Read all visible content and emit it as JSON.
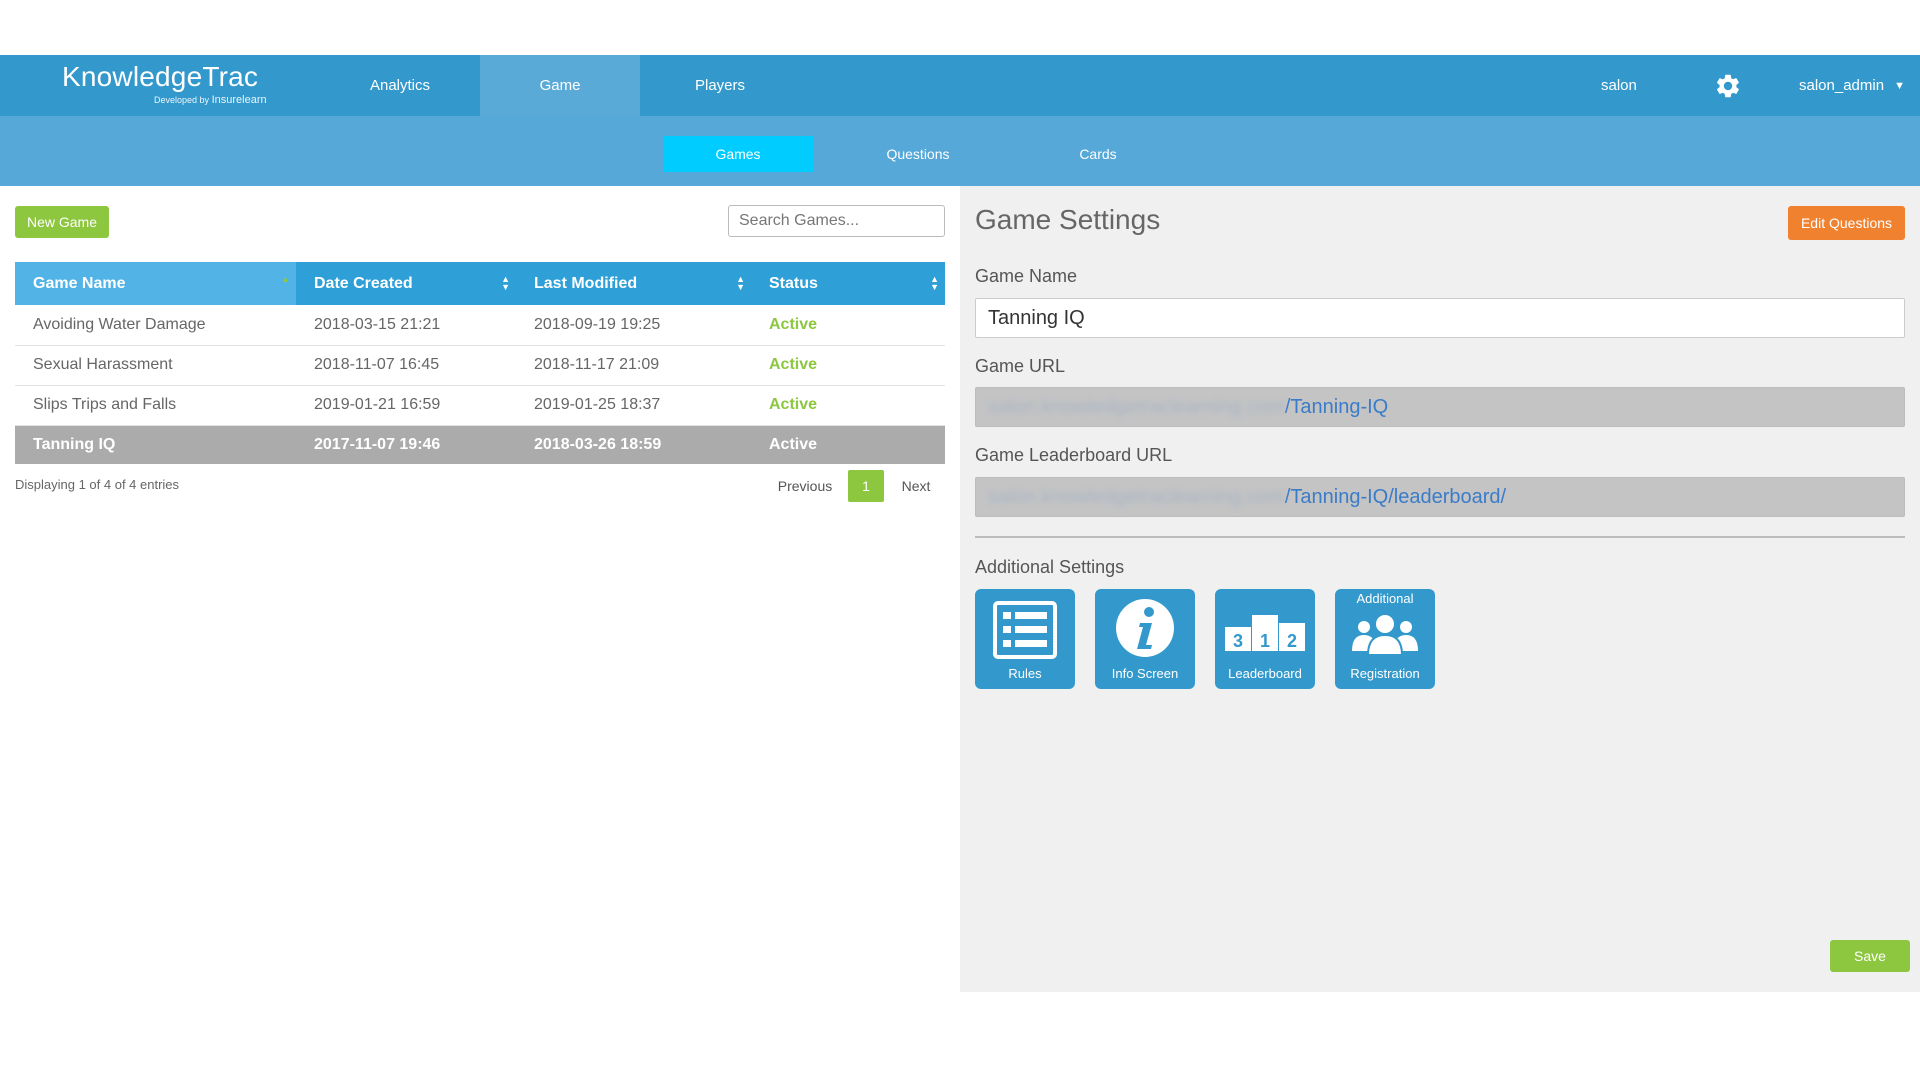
{
  "brand": {
    "name": "KnowledgeTrac",
    "sub_prefix": "Developed by",
    "sub_company": "Insurelearn"
  },
  "nav": {
    "items": [
      "Analytics",
      "Game",
      "Players"
    ],
    "active": "Game"
  },
  "user": {
    "org": "salon",
    "username": "salon_admin"
  },
  "subnav": {
    "items": [
      "Games",
      "Questions",
      "Cards"
    ],
    "active": "Games"
  },
  "left": {
    "new_game_label": "New Game",
    "search_placeholder": "Search Games...",
    "columns": [
      "Game Name",
      "Date Created",
      "Last Modified",
      "Status"
    ],
    "rows": [
      {
        "name": "Avoiding Water Damage",
        "created": "2018-03-15 21:21",
        "modified": "2018-09-19 19:25",
        "status": "Active"
      },
      {
        "name": "Sexual Harassment",
        "created": "2018-11-07 16:45",
        "modified": "2018-11-17 21:09",
        "status": "Active"
      },
      {
        "name": "Slips Trips and Falls",
        "created": "2019-01-21 16:59",
        "modified": "2019-01-25 18:37",
        "status": "Active"
      },
      {
        "name": "Tanning IQ",
        "created": "2017-11-07 19:46",
        "modified": "2018-03-26 18:59",
        "status": "Active"
      }
    ],
    "info": "Displaying 1 of 4 of 4 entries",
    "pager": {
      "previous": "Previous",
      "current": "1",
      "next": "Next"
    }
  },
  "settings": {
    "title": "Game Settings",
    "edit_questions_label": "Edit Questions",
    "game_name_label": "Game Name",
    "game_name_value": "Tanning IQ",
    "game_url_label": "Game URL",
    "game_url_host": "salon.knowledgetraclearning.com",
    "game_url_path": "/Tanning-IQ",
    "leaderboard_url_label": "Game Leaderboard URL",
    "leaderboard_url_host": "salon.knowledgetraclearning.com",
    "leaderboard_url_path": "/Tanning-IQ/leaderboard/",
    "additional_label": "Additional Settings",
    "tiles": [
      {
        "label": "Rules",
        "icon": "list-icon"
      },
      {
        "label": "Info Screen",
        "icon": "info-icon"
      },
      {
        "label": "Leaderboard",
        "icon": "podium-icon",
        "podium": [
          "3",
          "1",
          "2"
        ]
      },
      {
        "label": "Registration",
        "top_label": "Additional",
        "icon": "group-icon"
      }
    ],
    "save_label": "Save"
  },
  "colors": {
    "primary": "#3399cc",
    "subnav": "#55a8d8",
    "active_subtab": "#00ccff",
    "green": "#8dc63f",
    "orange": "#f0812f"
  }
}
